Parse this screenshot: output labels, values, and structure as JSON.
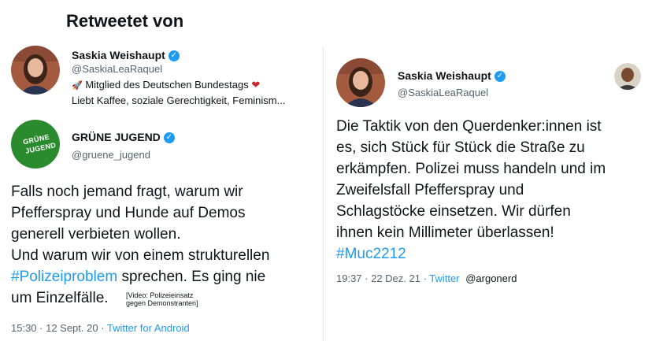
{
  "header": {
    "title": "Retweetet von"
  },
  "retweeter": {
    "name": "Saskia Weishaupt",
    "handle": "@SaskiaLeaRaquel",
    "bio_line1_icon": "🚀",
    "bio_line1": "Mitglied des Deutschen Bundestags",
    "bio_line1_heart": "❤",
    "bio_line2": "Liebt Kaffee, soziale Gerechtigkeit, Feminism..."
  },
  "left_tweet": {
    "author_name": "GRÜNE JUGEND",
    "author_handle": "@gruene_jugend",
    "logo_text_1": "GRÜNE",
    "logo_text_2": "JUGEND",
    "line1": "Falls noch jemand fragt, warum wir",
    "line2": "Pfefferspray und Hunde auf Demos",
    "line3": "generell verbieten wollen.",
    "line4": "Und warum wir von einem strukturellen",
    "hashtag": "#Polizeiproblem",
    "line5_rest": " sprechen. Es ging nie",
    "line6": "um Einzelfälle.",
    "video_note_1": "[Video: Polizeieinsatz",
    "video_note_2": "gegen Demonstranten]",
    "time": "15:30 · 12 Sept. 20 · ",
    "client": "Twitter for Android"
  },
  "right_tweet": {
    "author_name": "Saskia Weishaupt",
    "author_handle": "@SaskiaLeaRaquel",
    "line1": "Die Taktik von den Querdenker:innen ist",
    "line2": "es, sich Stück für Stück die Straße zu",
    "line3": "erkämpfen. Polizei muss handeln und im",
    "line4": "Zweifelsfall Pfefferspray und",
    "line5": "Schlagstöcke einsetzen. Wir dürfen",
    "line6": "ihnen kein Millimeter überlassen!",
    "hashtag": "#Muc2212",
    "time": "19:37 · 22 Dez. 21 · ",
    "client": "Twitter",
    "credit": "@argonerd"
  },
  "colors": {
    "accent": "#1d9bf0",
    "muted": "#536471",
    "green": "#2a8a2e"
  }
}
